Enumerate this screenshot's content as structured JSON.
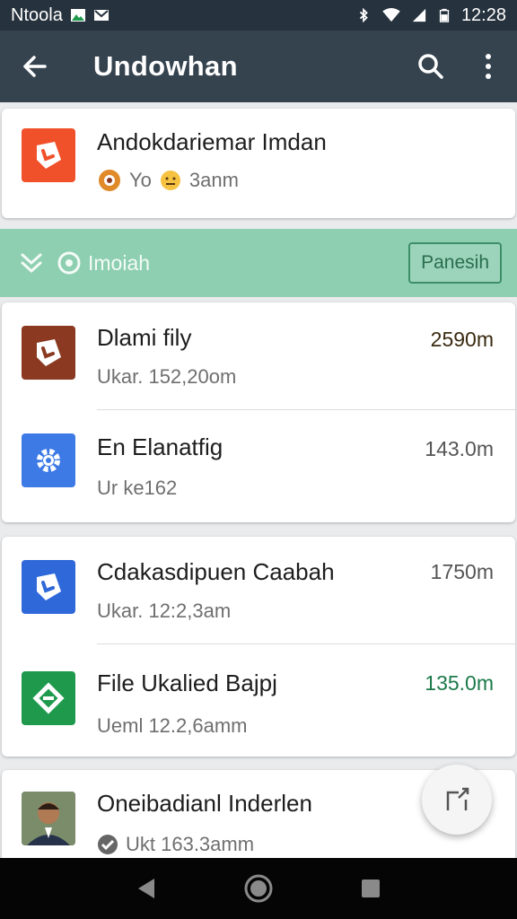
{
  "status_bar": {
    "carrier": "Ntoola",
    "time": "12:28"
  },
  "app_bar": {
    "title": "Undowhan"
  },
  "top_card": {
    "title": "Andokdariemar Imdan",
    "sub_a": "Yo",
    "sub_b": "3anm",
    "icon_color": "#f0512a"
  },
  "section": {
    "label": "Imoiah",
    "button_label": "Panesih",
    "bg_color": "#8ecfb1"
  },
  "group1": [
    {
      "title": "Dlami fily",
      "subtitle": "Ukar. 152,20om",
      "size": "2590m",
      "size_color": "#3a2a10",
      "icon_color": "#8b3a21",
      "icon": "tag-icon"
    },
    {
      "title": "En Elanatfig",
      "subtitle": "Ur ke162",
      "size": "143.0m",
      "size_color": "#5b5b5b",
      "icon_color": "#3d7ae6",
      "icon": "gear-icon"
    }
  ],
  "group2": [
    {
      "title": "Cdakasdipuen Caabah",
      "subtitle": "Ukar. 12:2,3am",
      "size": "1750m",
      "size_color": "#5b5b5b",
      "icon_color": "#2f68d9",
      "icon": "tag-icon"
    },
    {
      "title": "File Ukalied Bajpj",
      "subtitle": "Ueml 12.2,6amm",
      "size": "135.0m",
      "size_color": "#1c7a4a",
      "icon_color": "#1f9a4d",
      "icon": "share-icon"
    }
  ],
  "group3": [
    {
      "title": "Oneibadianl Inderlen",
      "subtitle": "Ukt 163.3amm",
      "icon": "avatar"
    }
  ]
}
